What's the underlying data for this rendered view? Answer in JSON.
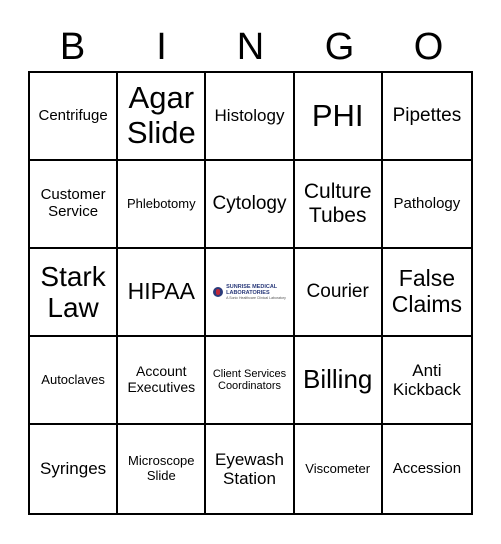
{
  "header": [
    "B",
    "I",
    "N",
    "G",
    "O"
  ],
  "cells": [
    "Centrifuge",
    "Agar Slide",
    "Histology",
    "PHI",
    "Pipettes",
    "Customer Service",
    "Phlebotomy",
    "Cytology",
    "Culture Tubes",
    "Pathology",
    "Stark Law",
    "HIPAA",
    "",
    "Courier",
    "False Claims",
    "Autoclaves",
    "Account Executives",
    "Client Services Coordinators",
    "Billing",
    "Anti Kickback",
    "Syringes",
    "Microscope Slide",
    "Eyewash Station",
    "Viscometer",
    "Accession"
  ],
  "free_space": {
    "logo_icon": "sunrise-medical-logo-icon",
    "line1": "SUNRISE MEDICAL",
    "line2": "LABORATORIES",
    "line3": "A Sonic Healthcare Clinical Laboratory"
  },
  "colors": {
    "grid": "#000000",
    "logo_primary": "#2a3a7a",
    "logo_accent": "#c0283a"
  }
}
